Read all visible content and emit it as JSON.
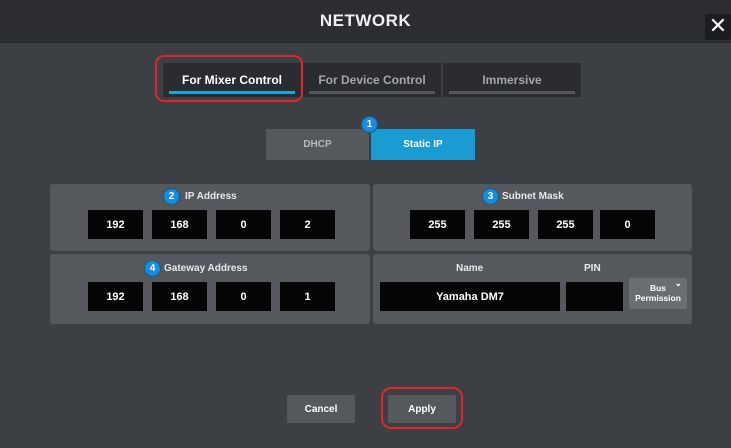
{
  "window": {
    "title": "NETWORK",
    "close_glyph": "✕"
  },
  "tabs": [
    {
      "label": "For Mixer Control",
      "active": true
    },
    {
      "label": "For Device Control",
      "active": false
    },
    {
      "label": "Immersive",
      "active": false
    }
  ],
  "mode": {
    "options": [
      "DHCP",
      "Static IP"
    ],
    "selected": "Static IP"
  },
  "badges": [
    "1",
    "2",
    "3",
    "4"
  ],
  "ip_address": {
    "label": "IP Address",
    "octets": [
      "192",
      "168",
      "0",
      "2"
    ]
  },
  "subnet_mask": {
    "label": "Subnet Mask",
    "octets": [
      "255",
      "255",
      "255",
      "0"
    ]
  },
  "gateway_address": {
    "label": "Gateway Address",
    "octets": [
      "192",
      "168",
      "0",
      "1"
    ]
  },
  "device": {
    "name_label": "Name",
    "name_value": "Yamaha DM7",
    "pin_label": "PIN",
    "pin_value": "",
    "bus_line1": "Bus",
    "bus_line2": "Permission"
  },
  "actions": {
    "cancel_label": "Cancel",
    "apply_label": "Apply"
  },
  "colors": {
    "accent": "#1a9bd2",
    "highlight": "#e0262b",
    "badge": "#1a8cd8"
  }
}
